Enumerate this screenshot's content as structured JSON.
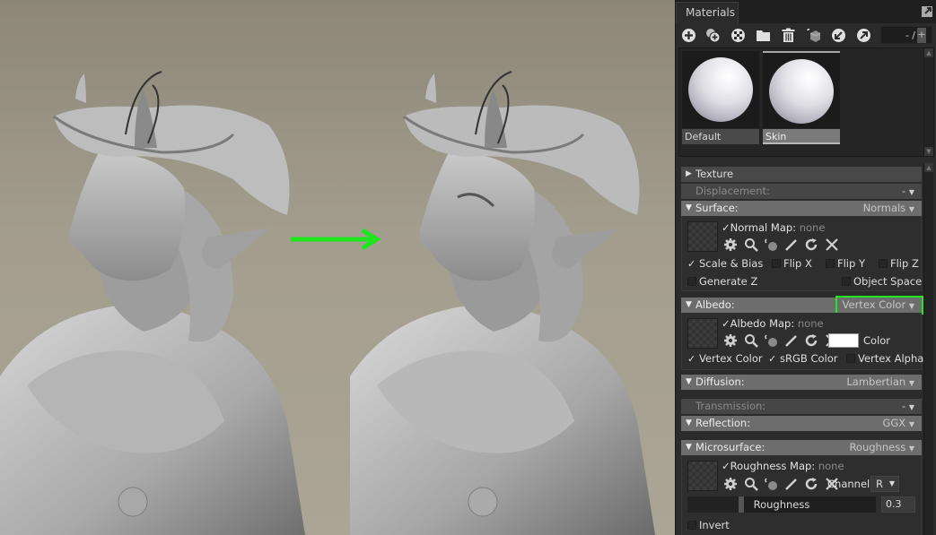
{
  "viewport": {
    "background_color": "#a19c8c",
    "annotation_arrow_color": "#1ee51e",
    "figures": [
      "before-render",
      "after-render"
    ]
  },
  "panel": {
    "tab_label": "Materials",
    "pager": {
      "text": "- /",
      "plus": "+"
    },
    "toolbar_icons": [
      "add-material-icon",
      "duplicate-material-icon",
      "checker-icon",
      "folder-icon",
      "trash-icon",
      "pick-material-icon",
      "import-icon",
      "export-icon"
    ],
    "materials": [
      {
        "name": "Default",
        "selected": false
      },
      {
        "name": "Skin",
        "selected": true
      }
    ],
    "sections": {
      "texture": {
        "label": "Texture"
      },
      "displacement": {
        "label": "Displacement:",
        "value": "-"
      },
      "surface": {
        "label": "Surface:",
        "value": "Normals",
        "map_label": "Normal Map:",
        "map_value": "none",
        "options": [
          {
            "label": "Scale & Bias",
            "checked": true
          },
          {
            "label": "Flip X",
            "checked": false
          },
          {
            "label": "Flip Y",
            "checked": false
          },
          {
            "label": "Flip Z",
            "checked": false
          },
          {
            "label": "Generate Z",
            "checked": false
          },
          {
            "label": "Object Space",
            "checked": false
          }
        ]
      },
      "albedo": {
        "label": "Albedo:",
        "value": "Vertex Color",
        "map_label": "Albedo Map:",
        "map_value": "none",
        "color_label": "Color",
        "color_value": "#ffffff",
        "options": [
          {
            "label": "Vertex Color",
            "checked": true
          },
          {
            "label": "sRGB Color",
            "checked": true
          },
          {
            "label": "Vertex Alpha",
            "checked": false
          }
        ]
      },
      "diffusion": {
        "label": "Diffusion:",
        "value": "Lambertian"
      },
      "transmission": {
        "label": "Transmission:",
        "value": "-"
      },
      "reflection": {
        "label": "Reflection:",
        "value": "GGX"
      },
      "microsurface": {
        "label": "Microsurface:",
        "value": "Roughness",
        "map_label": "Roughness Map:",
        "map_value": "none",
        "channel_label": "Channel",
        "channel_value": "R",
        "slider_label": "Roughness",
        "slider_value": "0.3",
        "slider_fraction": 0.3,
        "invert_label": "Invert",
        "invert_checked": false
      }
    }
  }
}
